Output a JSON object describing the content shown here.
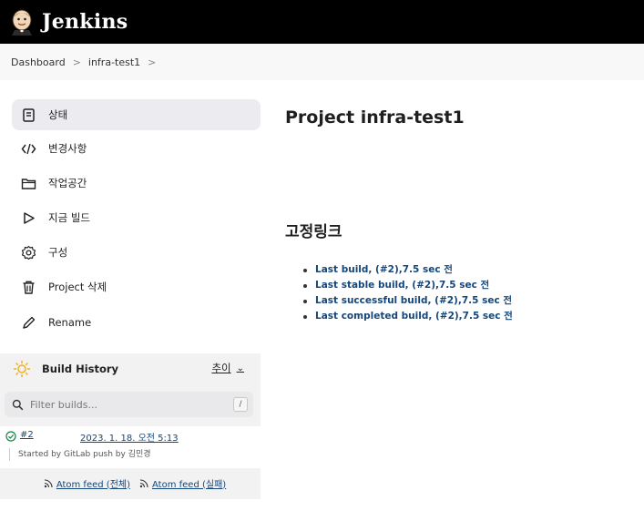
{
  "header": {
    "app_title": "Jenkins",
    "logo_icon": "jenkins-butler-icon"
  },
  "breadcrumb": {
    "items": [
      "Dashboard",
      "infra-test1"
    ],
    "separator": ">"
  },
  "sidebar": {
    "tasks": [
      {
        "label": "상태",
        "icon": "notepad-icon",
        "active": true
      },
      {
        "label": "변경사항",
        "icon": "code-icon"
      },
      {
        "label": "작업공간",
        "icon": "folder-icon"
      },
      {
        "label": "지금 빌드",
        "icon": "play-icon"
      },
      {
        "label": "구성",
        "icon": "gear-icon"
      },
      {
        "label": "Project 삭제",
        "icon": "trash-icon"
      },
      {
        "label": "Rename",
        "icon": "pencil-icon"
      }
    ]
  },
  "build_history": {
    "title": "Build History",
    "trend_label": "추이",
    "filter_placeholder": "Filter builds...",
    "shortcut_key": "/",
    "builds": [
      {
        "number": "#2",
        "time": "2023. 1. 18. 오전 5:13",
        "cause": "Started by GitLab push by 김민경",
        "status": "success"
      }
    ],
    "feeds": {
      "all": "Atom feed (전체)",
      "failures": "Atom feed (실패)"
    }
  },
  "main": {
    "title": "Project infra-test1",
    "permalinks_title": "고정링크",
    "permalinks": [
      "Last build, (#2),7.5 sec 전",
      "Last stable build, (#2),7.5 sec 전",
      "Last successful build, (#2),7.5 sec 전",
      "Last completed build, (#2),7.5 sec 전"
    ]
  },
  "colors": {
    "header_bg": "#000000",
    "link": "#14467a",
    "success": "#138347",
    "active_task_bg": "#ececf0"
  }
}
